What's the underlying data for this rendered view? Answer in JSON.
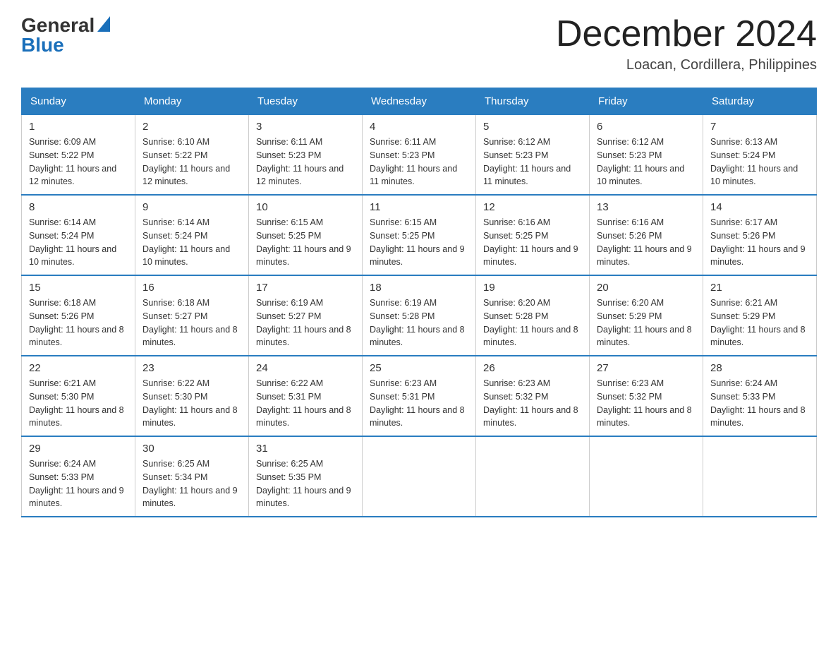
{
  "header": {
    "logo_general": "General",
    "logo_blue": "Blue",
    "title": "December 2024",
    "subtitle": "Loacan, Cordillera, Philippines"
  },
  "days_of_week": [
    "Sunday",
    "Monday",
    "Tuesday",
    "Wednesday",
    "Thursday",
    "Friday",
    "Saturday"
  ],
  "weeks": [
    [
      {
        "day": "1",
        "sunrise": "6:09 AM",
        "sunset": "5:22 PM",
        "daylight": "11 hours and 12 minutes."
      },
      {
        "day": "2",
        "sunrise": "6:10 AM",
        "sunset": "5:22 PM",
        "daylight": "11 hours and 12 minutes."
      },
      {
        "day": "3",
        "sunrise": "6:11 AM",
        "sunset": "5:23 PM",
        "daylight": "11 hours and 12 minutes."
      },
      {
        "day": "4",
        "sunrise": "6:11 AM",
        "sunset": "5:23 PM",
        "daylight": "11 hours and 11 minutes."
      },
      {
        "day": "5",
        "sunrise": "6:12 AM",
        "sunset": "5:23 PM",
        "daylight": "11 hours and 11 minutes."
      },
      {
        "day": "6",
        "sunrise": "6:12 AM",
        "sunset": "5:23 PM",
        "daylight": "11 hours and 10 minutes."
      },
      {
        "day": "7",
        "sunrise": "6:13 AM",
        "sunset": "5:24 PM",
        "daylight": "11 hours and 10 minutes."
      }
    ],
    [
      {
        "day": "8",
        "sunrise": "6:14 AM",
        "sunset": "5:24 PM",
        "daylight": "11 hours and 10 minutes."
      },
      {
        "day": "9",
        "sunrise": "6:14 AM",
        "sunset": "5:24 PM",
        "daylight": "11 hours and 10 minutes."
      },
      {
        "day": "10",
        "sunrise": "6:15 AM",
        "sunset": "5:25 PM",
        "daylight": "11 hours and 9 minutes."
      },
      {
        "day": "11",
        "sunrise": "6:15 AM",
        "sunset": "5:25 PM",
        "daylight": "11 hours and 9 minutes."
      },
      {
        "day": "12",
        "sunrise": "6:16 AM",
        "sunset": "5:25 PM",
        "daylight": "11 hours and 9 minutes."
      },
      {
        "day": "13",
        "sunrise": "6:16 AM",
        "sunset": "5:26 PM",
        "daylight": "11 hours and 9 minutes."
      },
      {
        "day": "14",
        "sunrise": "6:17 AM",
        "sunset": "5:26 PM",
        "daylight": "11 hours and 9 minutes."
      }
    ],
    [
      {
        "day": "15",
        "sunrise": "6:18 AM",
        "sunset": "5:26 PM",
        "daylight": "11 hours and 8 minutes."
      },
      {
        "day": "16",
        "sunrise": "6:18 AM",
        "sunset": "5:27 PM",
        "daylight": "11 hours and 8 minutes."
      },
      {
        "day": "17",
        "sunrise": "6:19 AM",
        "sunset": "5:27 PM",
        "daylight": "11 hours and 8 minutes."
      },
      {
        "day": "18",
        "sunrise": "6:19 AM",
        "sunset": "5:28 PM",
        "daylight": "11 hours and 8 minutes."
      },
      {
        "day": "19",
        "sunrise": "6:20 AM",
        "sunset": "5:28 PM",
        "daylight": "11 hours and 8 minutes."
      },
      {
        "day": "20",
        "sunrise": "6:20 AM",
        "sunset": "5:29 PM",
        "daylight": "11 hours and 8 minutes."
      },
      {
        "day": "21",
        "sunrise": "6:21 AM",
        "sunset": "5:29 PM",
        "daylight": "11 hours and 8 minutes."
      }
    ],
    [
      {
        "day": "22",
        "sunrise": "6:21 AM",
        "sunset": "5:30 PM",
        "daylight": "11 hours and 8 minutes."
      },
      {
        "day": "23",
        "sunrise": "6:22 AM",
        "sunset": "5:30 PM",
        "daylight": "11 hours and 8 minutes."
      },
      {
        "day": "24",
        "sunrise": "6:22 AM",
        "sunset": "5:31 PM",
        "daylight": "11 hours and 8 minutes."
      },
      {
        "day": "25",
        "sunrise": "6:23 AM",
        "sunset": "5:31 PM",
        "daylight": "11 hours and 8 minutes."
      },
      {
        "day": "26",
        "sunrise": "6:23 AM",
        "sunset": "5:32 PM",
        "daylight": "11 hours and 8 minutes."
      },
      {
        "day": "27",
        "sunrise": "6:23 AM",
        "sunset": "5:32 PM",
        "daylight": "11 hours and 8 minutes."
      },
      {
        "day": "28",
        "sunrise": "6:24 AM",
        "sunset": "5:33 PM",
        "daylight": "11 hours and 8 minutes."
      }
    ],
    [
      {
        "day": "29",
        "sunrise": "6:24 AM",
        "sunset": "5:33 PM",
        "daylight": "11 hours and 9 minutes."
      },
      {
        "day": "30",
        "sunrise": "6:25 AM",
        "sunset": "5:34 PM",
        "daylight": "11 hours and 9 minutes."
      },
      {
        "day": "31",
        "sunrise": "6:25 AM",
        "sunset": "5:35 PM",
        "daylight": "11 hours and 9 minutes."
      },
      null,
      null,
      null,
      null
    ]
  ],
  "labels": {
    "sunrise": "Sunrise:",
    "sunset": "Sunset:",
    "daylight": "Daylight:"
  }
}
